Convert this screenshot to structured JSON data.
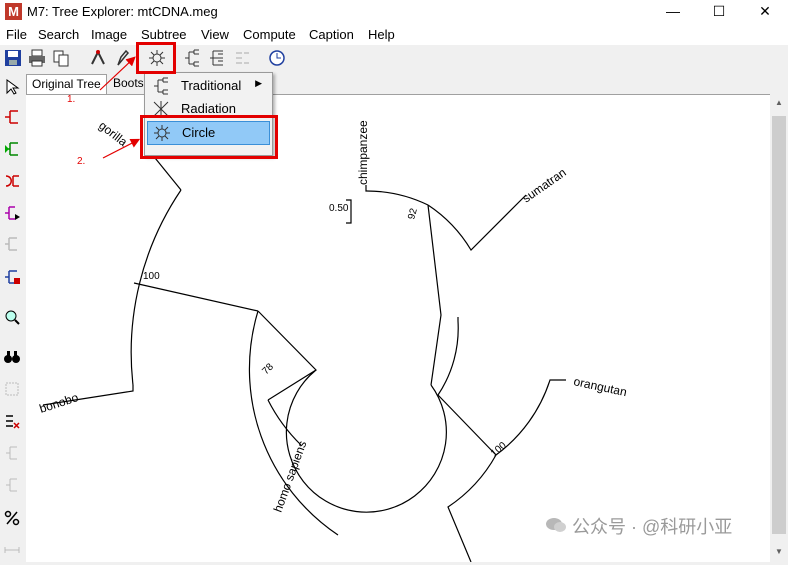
{
  "window": {
    "app_icon_letter": "M",
    "title": "M7: Tree Explorer: mtCDNA.meg",
    "minimize": "—",
    "maximize": "☐",
    "close": "✕"
  },
  "menu": [
    "File",
    "Search",
    "Image",
    "Subtree",
    "View",
    "Compute",
    "Caption",
    "Help"
  ],
  "tabs": {
    "original": "Original Tree",
    "bootstrap": "Boots"
  },
  "dropdown": {
    "items": [
      {
        "label": "Traditional",
        "arrow": "▶"
      },
      {
        "label": "Radiation"
      },
      {
        "label": "Circle"
      }
    ]
  },
  "annotations": {
    "step1": "1.",
    "step2": "2."
  },
  "tree": {
    "taxa": [
      "gorilla",
      "chimpanzee",
      "sumatran",
      "orangutan",
      "homo sapiens",
      "bonobo"
    ],
    "bootstrap": [
      "100",
      "78",
      "92",
      "100"
    ],
    "scale_label": "0.50"
  },
  "watermark": {
    "text": "公众号 · @科研小亚"
  },
  "scroll": {
    "up": "▲",
    "down": "▼"
  },
  "colors": {
    "highlight_box": "#e30000",
    "menu_highlight": "#91c9f7"
  }
}
